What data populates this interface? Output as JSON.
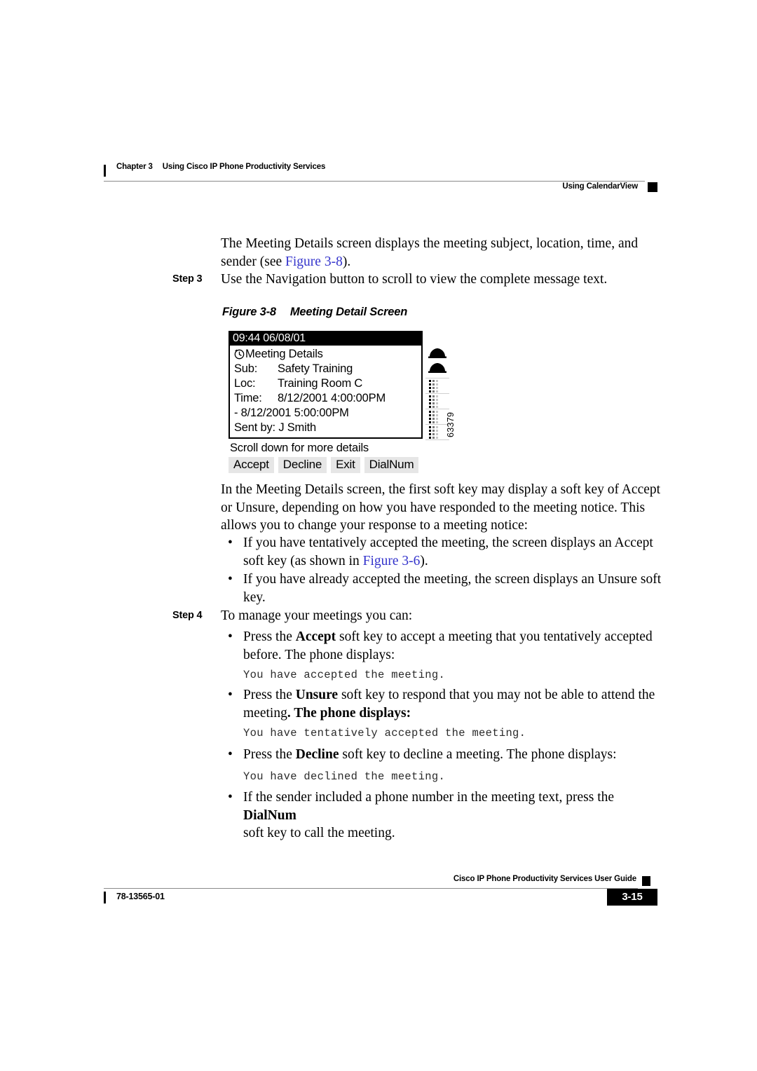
{
  "header": {
    "chapter_number": "Chapter 3",
    "chapter_title": "Using Cisco IP Phone Productivity Services",
    "section_title": "Using CalendarView"
  },
  "intro": {
    "line1": "The Meeting Details screen displays the meeting subject, location, time, and",
    "line2_pre": "sender (see ",
    "line2_link": "Figure 3-8",
    "line2_post": ")."
  },
  "step3": {
    "label": "Step 3",
    "text": "Use the Navigation button to scroll to view the complete message text."
  },
  "figure": {
    "caption_number": "Figure 3-8",
    "caption_title": "Meeting Detail Screen",
    "figure_id": "63379",
    "screen": {
      "titlebar": "09:44 06/08/01",
      "clock_icon": "clock-icon",
      "screen_heading": "Meeting Details",
      "rows": [
        {
          "label": "Sub:",
          "value": "Safety Training"
        },
        {
          "label": "Loc:",
          "value": "Training Room C"
        },
        {
          "label": "Time:",
          "value": "8/12/2001 4:00:00PM"
        }
      ],
      "time_continuation": "- 8/12/2001 5:00:00PM",
      "sent_by": "Sent by: J Smith",
      "hint": "Scroll down for more details",
      "softkeys": [
        "Accept",
        "Decline",
        "Exit",
        "DialNum"
      ],
      "line_icons": [
        "handset-icon",
        "handset-icon"
      ],
      "speeddial_rows": 4
    }
  },
  "body": {
    "para1_line1": "In the Meeting Details screen, the first soft key may display a soft key of Accept",
    "para1_line2": "or Unsure, depending on how you have responded to the meeting notice. This",
    "para1_line3": "allows you to change your response to a meeting notice:",
    "bullet1_line1": "If you have tentatively accepted the meeting, the screen displays an Accept",
    "bullet1_line2_pre": "soft key (as shown in ",
    "bullet1_line2_link": "Figure 3-6",
    "bullet1_line2_post": ").",
    "bullet2_line1": "If you have already accepted the meeting, the screen displays an Unsure soft",
    "bullet2_line2": "key."
  },
  "step4": {
    "label": "Step 4",
    "text": "To manage your meetings you can:",
    "bullets": [
      {
        "pre": "Press the ",
        "strong": "Accept",
        "post": " soft key to accept a meeting that you tentatively accepted",
        "line2": "before. The phone displays:",
        "code": "You have accepted the meeting."
      },
      {
        "pre": "Press the ",
        "strong": "Unsure",
        "post": " soft key to respond that you may not be able to attend the",
        "line2_pre": "meeting",
        "line2_post": ". The phone displays:",
        "code": "You have tentatively accepted the meeting."
      },
      {
        "pre": "Press the ",
        "strong": "Decline",
        "post": " soft key to decline a meeting. The phone displays:",
        "code": "You have declined the meeting."
      },
      {
        "pre": "If the sender included a phone number in the meeting text, press the ",
        "strong": "DialNum",
        "line2": "soft key to call the meeting."
      }
    ]
  },
  "footer": {
    "guide_title": "Cisco IP Phone Productivity Services User Guide",
    "document_number": "78-13565-01",
    "page_number": "3-15"
  },
  "colors": {
    "link": "#3434cc",
    "rule": "#8a8a8a",
    "softkey_bg": "#e6e6e6"
  }
}
